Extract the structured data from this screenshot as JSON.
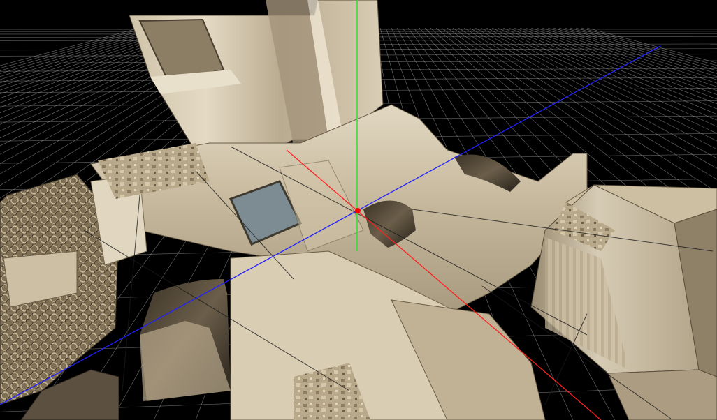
{
  "viewport": {
    "background_color": "#000000",
    "grid_line_color": "#c8c8c8",
    "grid_visible": true
  },
  "axes": {
    "x_axis_color": "#ff2020",
    "y_axis_color": "#30e030",
    "z_axis_color": "#2020ff",
    "origin_marker_color": "#ff0000"
  },
  "scene": {
    "description_icon": "3d-scene-icon",
    "stone_colors": {
      "light": "#d8ccb4",
      "mid": "#b8a98e",
      "dark": "#6a5c48",
      "shadow": "#2a241c",
      "cobble": "#8a7a60"
    }
  }
}
